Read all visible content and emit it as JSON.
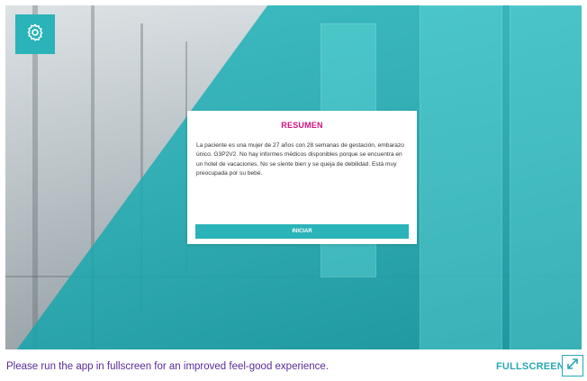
{
  "summary": {
    "title": "RESUMEN",
    "body": "La paciente es una mujer de 27 años con 28 semanas de gestación, embarazo único. G3P2V2. No hay informes médicos disponibles porque se encuentra en un hotel de vacaciones. No se siente bien y se queja de debilidad. Está muy preocupada por su bebé.",
    "start_label": "INICIAR"
  },
  "footer": {
    "message": "Please run the app in fullscreen for an improved feel-good experience.",
    "fullscreen_label": "FULLSCREEN"
  },
  "icons": {
    "settings": "gear-icon",
    "fullscreen": "expand-icon"
  },
  "colors": {
    "accent": "#2ab3b8",
    "title": "#d0137c",
    "footer_text": "#5a2a9a",
    "fullscreen_text": "#2aa7b6"
  }
}
